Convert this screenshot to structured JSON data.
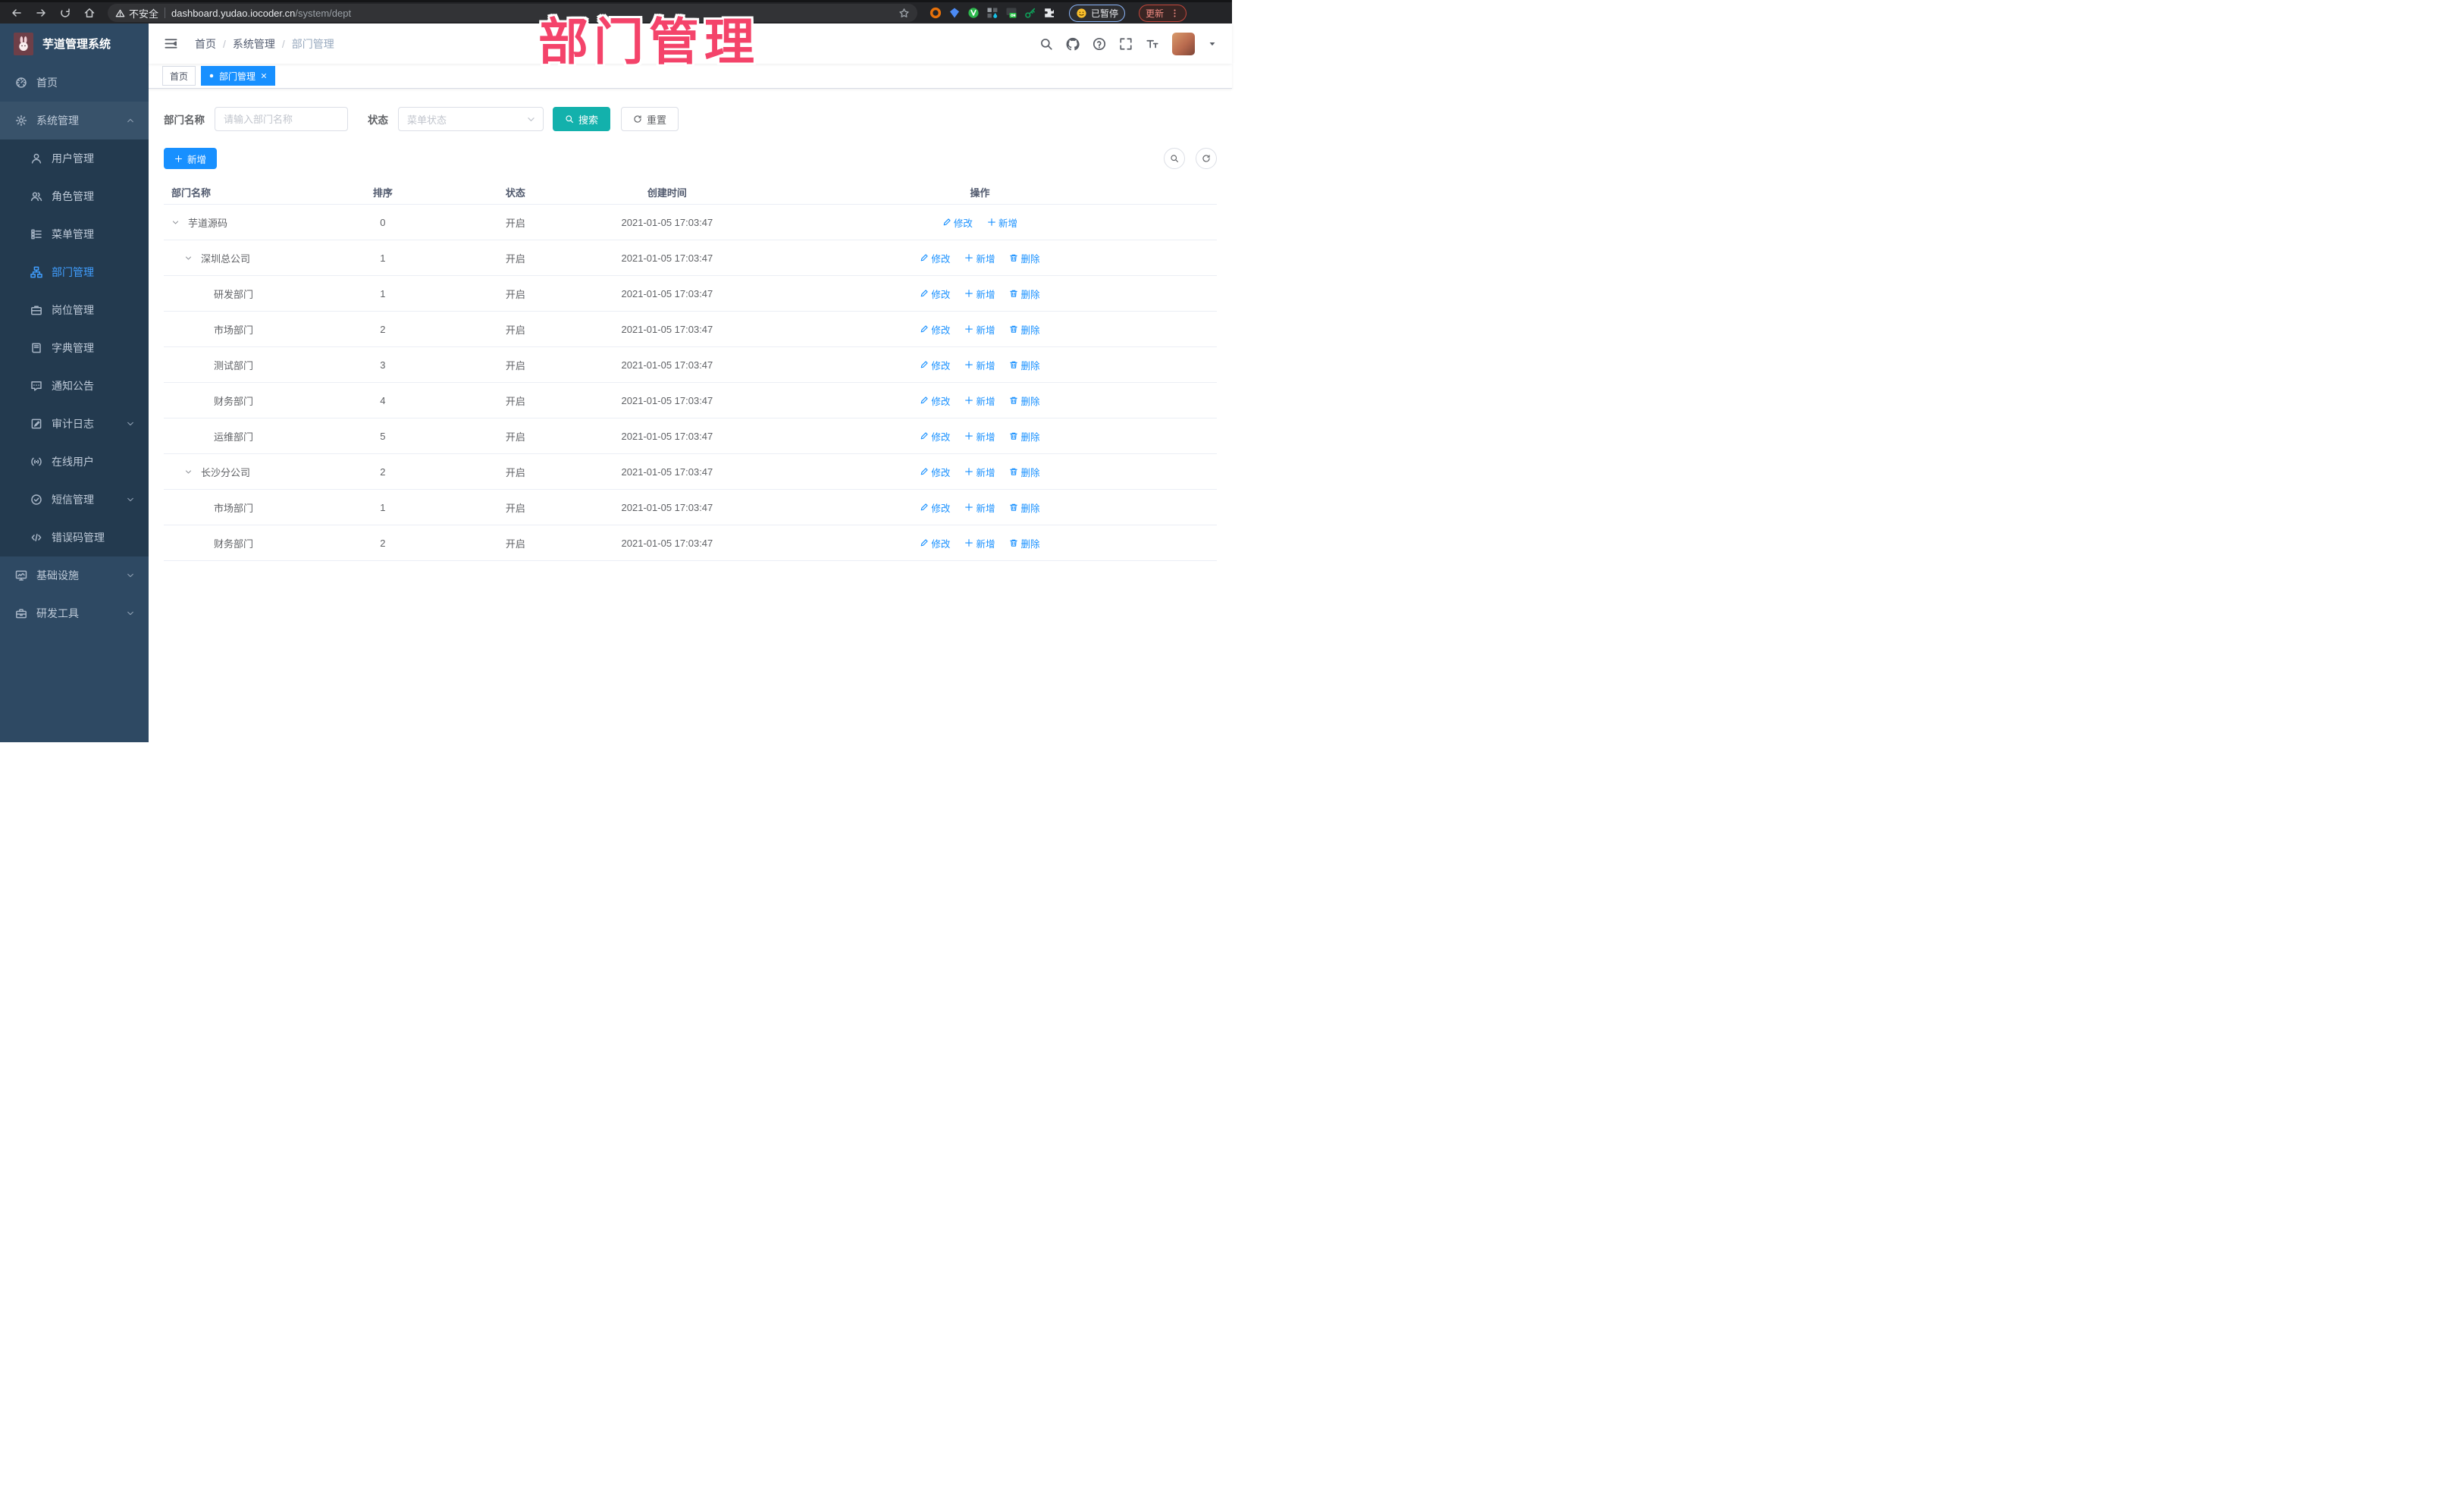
{
  "colors": {
    "accent": "#1890ff",
    "search_teal": "#13b1ac",
    "watermark_pink": "#f4436a",
    "sidebar_bg": "#2e4963",
    "submenu_bg": "#233a4f",
    "active_menu": "#409eff"
  },
  "watermark": "部门管理",
  "browser": {
    "nav_icons": [
      "arrow-left",
      "arrow-right",
      "reload",
      "home"
    ],
    "security_label": "不安全",
    "url_host": "dashboard.yudao.iocoder.cn",
    "url_path": "/system/dept",
    "extensions": [
      "ext-orange-ring",
      "ext-blue-gem",
      "ext-green-v",
      "ext-tiles-drop",
      "ext-on-badge",
      "ext-green-key",
      "ext-puzzle"
    ],
    "profile_label": "已暂停",
    "update_label": "更新"
  },
  "sidebar": {
    "logo_title": "芋道管理系统",
    "items": [
      {
        "id": "home",
        "label": "首页",
        "icon": "dashboard"
      },
      {
        "id": "system",
        "label": "系统管理",
        "icon": "gear",
        "chevron": "up",
        "open": true,
        "children": [
          {
            "id": "user",
            "label": "用户管理",
            "icon": "user"
          },
          {
            "id": "role",
            "label": "角色管理",
            "icon": "users"
          },
          {
            "id": "menu",
            "label": "菜单管理",
            "icon": "menu-list"
          },
          {
            "id": "dept",
            "label": "部门管理",
            "icon": "org-tree",
            "active": true
          },
          {
            "id": "post",
            "label": "岗位管理",
            "icon": "briefcase"
          },
          {
            "id": "dict",
            "label": "字典管理",
            "icon": "book"
          },
          {
            "id": "notice",
            "label": "通知公告",
            "icon": "chat"
          },
          {
            "id": "audit-log",
            "label": "审计日志",
            "icon": "log",
            "chevron": "down"
          },
          {
            "id": "online-user",
            "label": "在线用户",
            "icon": "online"
          },
          {
            "id": "sms",
            "label": "短信管理",
            "icon": "sms-check",
            "chevron": "down"
          },
          {
            "id": "error-code",
            "label": "错误码管理",
            "icon": "code"
          }
        ]
      },
      {
        "id": "infra",
        "label": "基础设施",
        "icon": "monitor",
        "chevron": "down"
      },
      {
        "id": "dev-tool",
        "label": "研发工具",
        "icon": "toolbox",
        "chevron": "down"
      }
    ]
  },
  "app_header": {
    "breadcrumb": [
      "首页",
      "系统管理",
      "部门管理"
    ],
    "breadcrumb_separator": "/",
    "action_icons": [
      "search",
      "github",
      "help",
      "fullscreen",
      "font-size"
    ]
  },
  "tabs": [
    {
      "label": "首页",
      "active": false
    },
    {
      "label": "部门管理",
      "active": true,
      "closable": true
    }
  ],
  "filters": {
    "dept_label": "部门名称",
    "dept_placeholder": "请输入部门名称",
    "status_label": "状态",
    "status_placeholder": "菜单状态",
    "search_label": "搜索",
    "reset_label": "重置"
  },
  "toolbar": {
    "add_label": "新增"
  },
  "table": {
    "columns": [
      "部门名称",
      "排序",
      "状态",
      "创建时间",
      "操作"
    ],
    "action_labels": {
      "edit": "修改",
      "add": "新增",
      "delete": "删除"
    },
    "rows": [
      {
        "name": "芋道源码",
        "level": 0,
        "expandable": true,
        "sort": "0",
        "status": "开启",
        "created": "2021-01-05 17:03:47",
        "actions": [
          "edit",
          "add"
        ]
      },
      {
        "name": "深圳总公司",
        "level": 1,
        "expandable": true,
        "sort": "1",
        "status": "开启",
        "created": "2021-01-05 17:03:47",
        "actions": [
          "edit",
          "add",
          "delete"
        ]
      },
      {
        "name": "研发部门",
        "level": 2,
        "expandable": false,
        "sort": "1",
        "status": "开启",
        "created": "2021-01-05 17:03:47",
        "actions": [
          "edit",
          "add",
          "delete"
        ]
      },
      {
        "name": "市场部门",
        "level": 2,
        "expandable": false,
        "sort": "2",
        "status": "开启",
        "created": "2021-01-05 17:03:47",
        "actions": [
          "edit",
          "add",
          "delete"
        ]
      },
      {
        "name": "测试部门",
        "level": 2,
        "expandable": false,
        "sort": "3",
        "status": "开启",
        "created": "2021-01-05 17:03:47",
        "actions": [
          "edit",
          "add",
          "delete"
        ]
      },
      {
        "name": "财务部门",
        "level": 2,
        "expandable": false,
        "sort": "4",
        "status": "开启",
        "created": "2021-01-05 17:03:47",
        "actions": [
          "edit",
          "add",
          "delete"
        ]
      },
      {
        "name": "运维部门",
        "level": 2,
        "expandable": false,
        "sort": "5",
        "status": "开启",
        "created": "2021-01-05 17:03:47",
        "actions": [
          "edit",
          "add",
          "delete"
        ]
      },
      {
        "name": "长沙分公司",
        "level": 1,
        "expandable": true,
        "sort": "2",
        "status": "开启",
        "created": "2021-01-05 17:03:47",
        "actions": [
          "edit",
          "add",
          "delete"
        ]
      },
      {
        "name": "市场部门",
        "level": 2,
        "expandable": false,
        "sort": "1",
        "status": "开启",
        "created": "2021-01-05 17:03:47",
        "actions": [
          "edit",
          "add",
          "delete"
        ]
      },
      {
        "name": "财务部门",
        "level": 2,
        "expandable": false,
        "sort": "2",
        "status": "开启",
        "created": "2021-01-05 17:03:47",
        "actions": [
          "edit",
          "add",
          "delete"
        ]
      }
    ]
  }
}
